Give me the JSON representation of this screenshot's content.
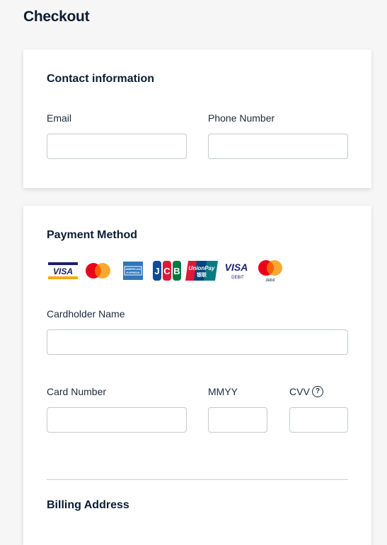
{
  "page": {
    "title": "Checkout"
  },
  "contact": {
    "title": "Contact information",
    "email_label": "Email",
    "email_value": "",
    "phone_label": "Phone Number",
    "phone_value": ""
  },
  "payment": {
    "title": "Payment Method",
    "brands": [
      {
        "name": "visa-icon",
        "text": "VISA"
      },
      {
        "name": "mastercard-icon",
        "text": ""
      },
      {
        "name": "american-express-icon",
        "text": "AMERICAN EXPRESS"
      },
      {
        "name": "jcb-icon",
        "text": "JCB"
      },
      {
        "name": "unionpay-icon",
        "text": "UnionPay 银联"
      },
      {
        "name": "visa-debit-icon",
        "text": "VISA DEBIT"
      },
      {
        "name": "mastercard-debit-icon",
        "text": "debit"
      }
    ],
    "cardholder_label": "Cardholder Name",
    "cardholder_value": "",
    "card_number_label": "Card Number",
    "card_number_value": "",
    "expiry_label": "MMYY",
    "expiry_value": "",
    "cvv_label": "CVV",
    "cvv_help": "?",
    "cvv_value": ""
  },
  "billing": {
    "title": "Billing Address"
  },
  "colors": {
    "accent_text": "#0b1d33",
    "border": "#c4c9cf",
    "background": "#f6f6f6"
  }
}
